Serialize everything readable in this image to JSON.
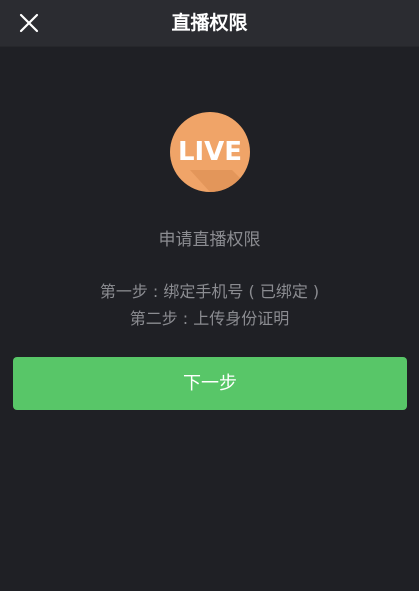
{
  "header": {
    "title": "直播权限",
    "close_icon": "close-icon"
  },
  "logo": {
    "text": "LIVE",
    "icon": "live-badge-icon"
  },
  "content": {
    "apply_title": "申请直播权限",
    "steps": [
      "第一步 : 绑定手机号 ( 已绑定 )",
      "第二步 : 上传身份证明"
    ]
  },
  "actions": {
    "next_label": "下一步"
  },
  "colors": {
    "background": "#1f2025",
    "header": "#2b2c31",
    "accent_green": "#58c668",
    "logo_orange": "#f0a468",
    "text_muted": "#8b8c91"
  }
}
